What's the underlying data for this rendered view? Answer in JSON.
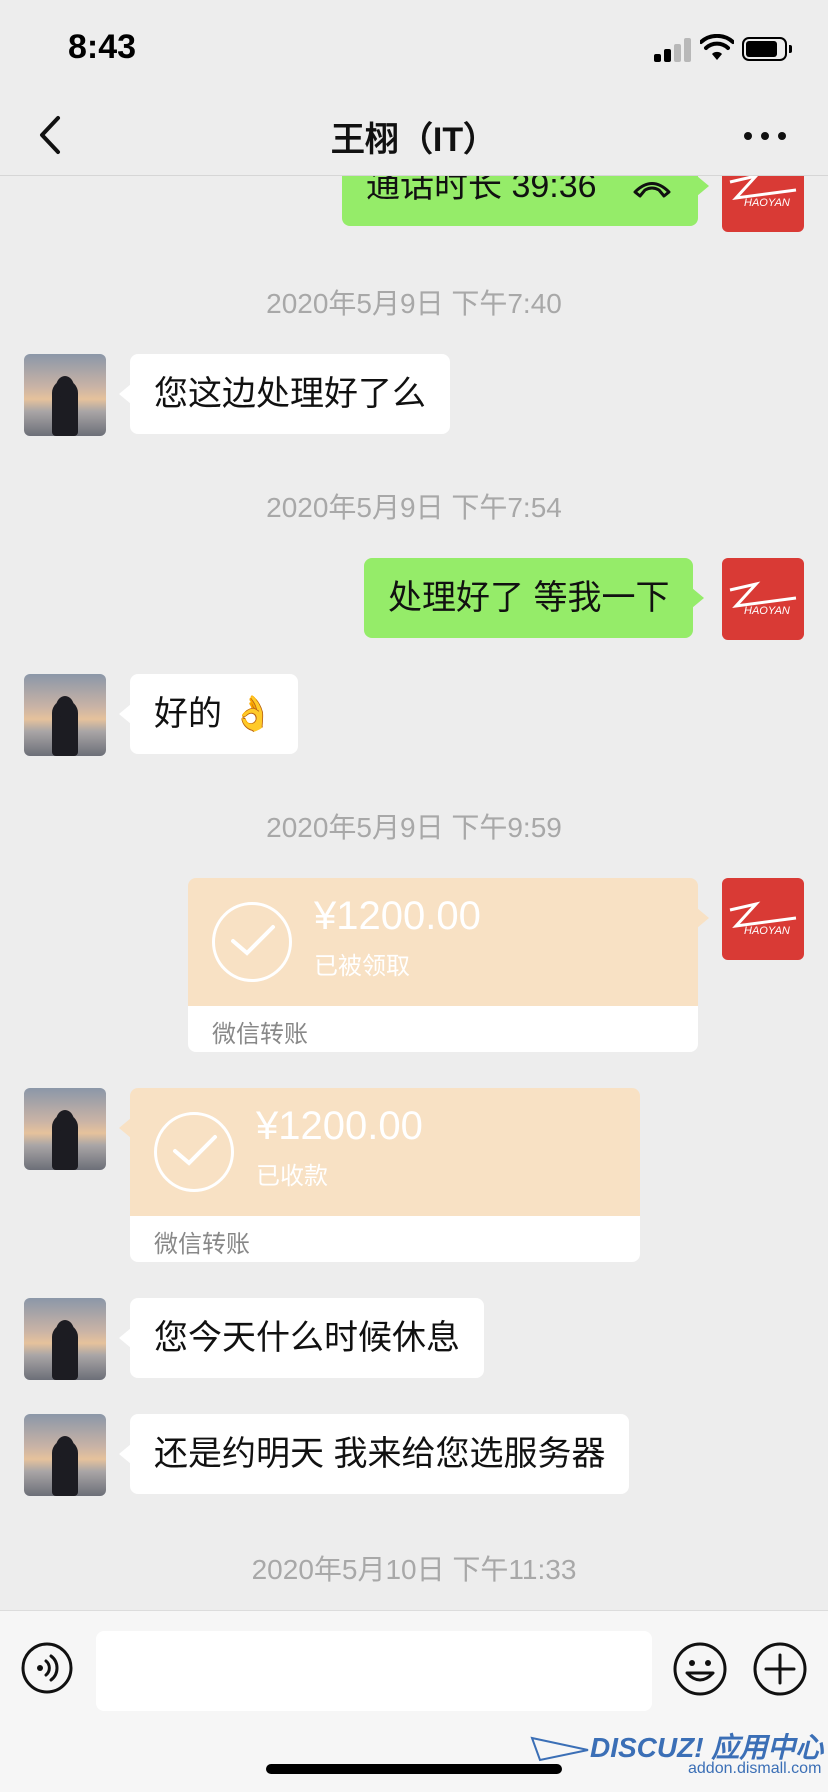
{
  "status_bar": {
    "time": "8:43"
  },
  "nav": {
    "title": "王栩（IT）"
  },
  "messages": {
    "call": {
      "text": "通话时长 39:36"
    },
    "ts1": "2020年5月9日 下午7:40",
    "m1": "您这边处理好了么",
    "ts2": "2020年5月9日 下午7:54",
    "m2": "处理好了 等我一下",
    "m3": "好的 👌",
    "ts3": "2020年5月9日 下午9:59",
    "transfer_sent": {
      "amount": "¥1200.00",
      "status": "已被领取",
      "label": "微信转账"
    },
    "transfer_received": {
      "amount": "¥1200.00",
      "status": "已收款",
      "label": "微信转账"
    },
    "m4": "您今天什么时候休息",
    "m5": "还是约明天 我来给您选服务器",
    "ts4": "2020年5月10日 下午11:33"
  },
  "input": {
    "placeholder": ""
  },
  "watermark": {
    "main": "DISCUZ! 应用中心",
    "sub": "addon.dismall.com"
  },
  "colors": {
    "bg": "#ededed",
    "green_bubble": "#95ec69",
    "transfer": "#f8e1c4",
    "avatar_red": "#d93a35"
  }
}
